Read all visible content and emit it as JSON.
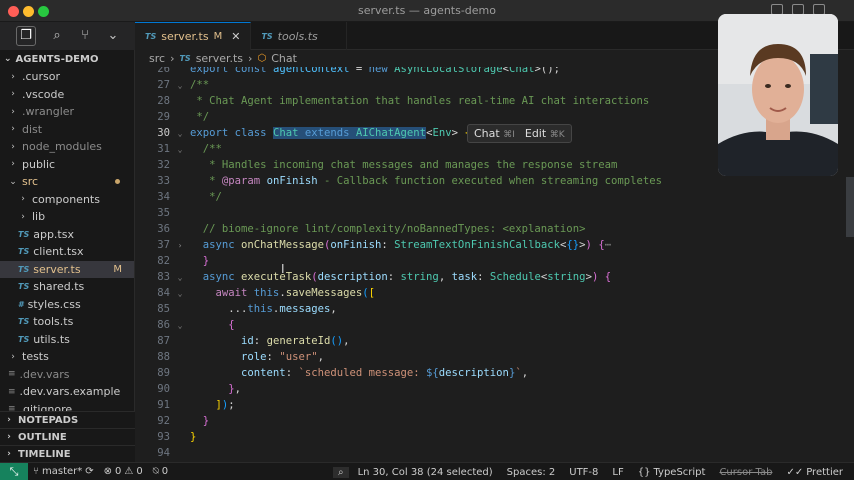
{
  "window": {
    "title": "server.ts — agents-demo"
  },
  "colors": {
    "accent": "#0078d4",
    "modified": "#e2c08d",
    "typescript": "#519aba",
    "remote": "#16825d"
  },
  "activity": {
    "icons": [
      "files-icon",
      "search-icon",
      "source-control-icon",
      "chevron-down-icon"
    ]
  },
  "explorer": {
    "project": "AGENTS-DEMO",
    "items": [
      {
        "label": ".cursor",
        "kind": "folder",
        "depth": 1
      },
      {
        "label": ".vscode",
        "kind": "folder",
        "depth": 1
      },
      {
        "label": ".wrangler",
        "kind": "folder",
        "depth": 1,
        "dim": true
      },
      {
        "label": "dist",
        "kind": "folder",
        "depth": 1,
        "dim": true
      },
      {
        "label": "node_modules",
        "kind": "folder",
        "depth": 1,
        "dim": true
      },
      {
        "label": "public",
        "kind": "folder",
        "depth": 1
      },
      {
        "label": "src",
        "kind": "folder-open",
        "depth": 1,
        "modified": true
      },
      {
        "label": "components",
        "kind": "folder",
        "depth": 2
      },
      {
        "label": "lib",
        "kind": "folder",
        "depth": 2
      },
      {
        "label": "app.tsx",
        "kind": "ts",
        "depth": 2
      },
      {
        "label": "client.tsx",
        "kind": "ts",
        "depth": 2
      },
      {
        "label": "server.ts",
        "kind": "ts",
        "depth": 2,
        "selected": true,
        "badge": "M"
      },
      {
        "label": "shared.ts",
        "kind": "ts",
        "depth": 2
      },
      {
        "label": "styles.css",
        "kind": "css",
        "depth": 2
      },
      {
        "label": "tools.ts",
        "kind": "ts",
        "depth": 2
      },
      {
        "label": "utils.ts",
        "kind": "ts",
        "depth": 2
      },
      {
        "label": "tests",
        "kind": "folder",
        "depth": 1
      },
      {
        "label": ".dev.vars",
        "kind": "cfg",
        "depth": 1,
        "dim": true
      },
      {
        "label": ".dev.vars.example",
        "kind": "cfg",
        "depth": 1
      },
      {
        "label": ".gitignore",
        "kind": "cfg",
        "depth": 1
      }
    ],
    "sections": [
      "NOTEPADS",
      "OUTLINE",
      "TIMELINE"
    ]
  },
  "tabs": [
    {
      "label": "server.ts",
      "lang": "TS",
      "modified": "M",
      "active": true
    },
    {
      "label": "tools.ts",
      "lang": "TS",
      "active": false
    }
  ],
  "breadcrumb": {
    "folder": "src",
    "lang": "TS",
    "file": "server.ts",
    "symbol": "Chat"
  },
  "editor": {
    "lines": [
      {
        "n": "26",
        "html": "<span class='k'>export</span> <span class='k'>const</span> <span class='v'>agentContext</span> = <span class='k'>new</span> <span class='t'>AsyncLocalStorage</span>&lt;<span class='t'>Chat</span>&gt;();"
      },
      {
        "n": "27",
        "fold": "v",
        "html": "<span class='c'>/**</span>"
      },
      {
        "n": "28",
        "html": "<span class='c'> * Chat Agent implementation that handles real-time AI chat interactions</span>"
      },
      {
        "n": "29",
        "html": "<span class='c'> */</span>"
      },
      {
        "n": "30",
        "fold": "v",
        "cur": true,
        "html": "<span class='k'>export</span> <span class='k'>class</span> <span class='t sel'>Chat</span><span class='sel'> </span><span class='k sel'>extends</span><span class='sel'> </span><span class='t sel'>AIChatAgent</span>&lt;<span class='t'>Env</span>&gt; <span class='br'>{</span>"
      },
      {
        "n": "31",
        "fold": "v",
        "html": "  <span class='c'>/**</span>"
      },
      {
        "n": "32",
        "html": "<span class='c'>   * Handles incoming chat messages and manages the response stream</span>"
      },
      {
        "n": "33",
        "html": "<span class='c'>   * </span><span class='kc'>@param</span> <span class='p'>onFinish</span><span class='c'> - Callback function executed when streaming completes</span>"
      },
      {
        "n": "34",
        "html": "<span class='c'>   */</span>"
      },
      {
        "n": "35",
        "html": ""
      },
      {
        "n": "36",
        "html": "  <span class='c'>// biome-ignore lint/complexity/noBannedTypes: &lt;explanation&gt;</span>"
      },
      {
        "n": "37",
        "fold": ">",
        "html": "  <span class='k'>async</span> <span class='f'>onChatMessage</span><span class='br2'>(</span><span class='p'>onFinish</span>: <span class='t'>StreamTextOnFinishCallback</span>&lt;<span class='br3'>{}</span>&gt;<span class='br2'>)</span> <span class='br2'>{</span><span class='ellips'>⋯</span>"
      },
      {
        "n": "82",
        "html": "  <span class='br2'>}</span>"
      },
      {
        "n": "83",
        "fold": "v",
        "html": "  <span class='k'>async</span> <span class='f'>executeTask</span><span class='br2'>(</span><span class='p'>description</span>: <span class='t'>string</span>, <span class='p'>task</span>: <span class='t'>Schedule</span>&lt;<span class='t'>string</span>&gt;<span class='br2'>)</span> <span class='br2'>{</span>"
      },
      {
        "n": "84",
        "fold": "v",
        "html": "    <span class='kc'>await</span> <span class='k'>this</span>.<span class='f'>saveMessages</span><span class='br3'>(</span><span class='br'>[</span>"
      },
      {
        "n": "85",
        "html": "      ...<span class='k'>this</span>.<span class='p'>messages</span>,"
      },
      {
        "n": "86",
        "fold": "v",
        "html": "      <span class='br2'>{</span>"
      },
      {
        "n": "87",
        "html": "        <span class='p'>id</span>: <span class='f'>generateId</span><span class='br3'>()</span>,"
      },
      {
        "n": "88",
        "html": "        <span class='p'>role</span>: <span class='s'>\"user\"</span>,"
      },
      {
        "n": "89",
        "html": "        <span class='p'>content</span>: <span class='s'>`scheduled message: </span><span class='k'>${</span><span class='p'>description</span><span class='k'>}</span><span class='s'>`</span>,"
      },
      {
        "n": "90",
        "html": "      <span class='br2'>}</span>,"
      },
      {
        "n": "91",
        "html": "    <span class='br'>]</span><span class='br3'>)</span>;"
      },
      {
        "n": "92",
        "html": "  <span class='br2'>}</span>"
      },
      {
        "n": "93",
        "html": "<span class='br'>}</span>"
      },
      {
        "n": "94",
        "html": ""
      }
    ],
    "hint": {
      "chat_label": "Chat",
      "chat_kbd": "⌘I",
      "edit_label": "Edit",
      "edit_kbd": "⌘K"
    }
  },
  "status": {
    "branch": "master*",
    "sync_icon": "sync-icon",
    "errors": "0",
    "warnings": "0",
    "ports": "0",
    "position": "Ln 30, Col 38 (24 selected)",
    "spaces": "Spaces: 2",
    "encoding": "UTF-8",
    "eol": "LF",
    "language": "TypeScript",
    "cursor_tab": "Cursor Tab",
    "formatter": "Prettier"
  }
}
